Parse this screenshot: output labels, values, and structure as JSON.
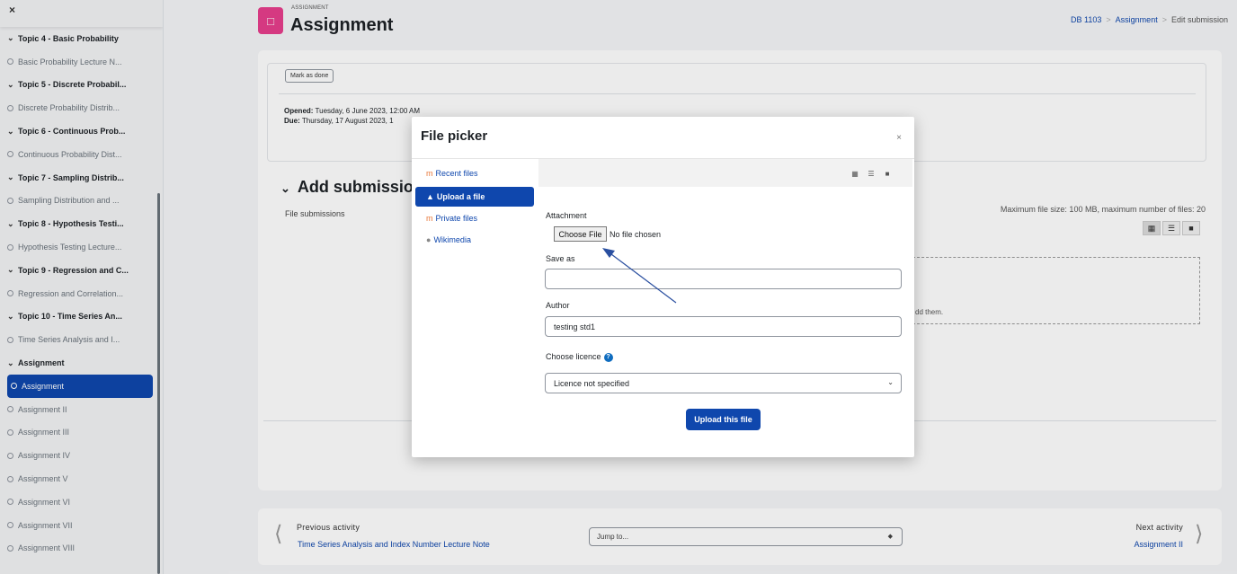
{
  "sidebar": {
    "close_label": "×",
    "items": [
      {
        "kind": "section",
        "label": "Topic 4 - Basic Probability"
      },
      {
        "kind": "activity",
        "label": "Basic Probability Lecture N..."
      },
      {
        "kind": "section",
        "label": "Topic 5 - Discrete Probabil..."
      },
      {
        "kind": "activity",
        "label": "Discrete Probability Distrib..."
      },
      {
        "kind": "section",
        "label": "Topic 6 - Continuous Prob..."
      },
      {
        "kind": "activity",
        "label": "Continuous Probability Dist..."
      },
      {
        "kind": "section",
        "label": "Topic 7 - Sampling Distrib..."
      },
      {
        "kind": "activity",
        "label": "Sampling Distribution and ..."
      },
      {
        "kind": "section",
        "label": "Topic 8 - Hypothesis Testi..."
      },
      {
        "kind": "activity",
        "label": "Hypothesis Testing Lecture..."
      },
      {
        "kind": "section",
        "label": "Topic 9 - Regression and C..."
      },
      {
        "kind": "activity",
        "label": "Regression and Correlation..."
      },
      {
        "kind": "section",
        "label": "Topic 10 - Time Series An..."
      },
      {
        "kind": "activity",
        "label": "Time Series Analysis and I..."
      },
      {
        "kind": "section",
        "label": "Assignment"
      },
      {
        "kind": "activity",
        "label": "Assignment",
        "active": true
      },
      {
        "kind": "activity",
        "label": "Assignment II"
      },
      {
        "kind": "activity",
        "label": "Assignment III"
      },
      {
        "kind": "activity",
        "label": "Assignment IV"
      },
      {
        "kind": "activity",
        "label": "Assignment V"
      },
      {
        "kind": "activity",
        "label": "Assignment VI"
      },
      {
        "kind": "activity",
        "label": "Assignment VII"
      },
      {
        "kind": "activity",
        "label": "Assignment VIII"
      }
    ]
  },
  "header": {
    "module_type": "ASSIGNMENT",
    "title": "Assignment",
    "breadcrumb": {
      "course": "DB 1103",
      "activity": "Assignment",
      "current": "Edit submission",
      "sep": ">"
    }
  },
  "activity": {
    "mark_done_label": "Mark as done",
    "opened_label": "Opened:",
    "opened_value": "Tuesday, 6 June 2023, 12:00 AM",
    "due_label": "Due:",
    "due_value": "Thursday, 17 August 2023, 1"
  },
  "submission": {
    "heading": "Add submission",
    "file_submissions_label": "File submissions",
    "max_size_text": "Maximum file size: 100 MB, maximum number of files: 20",
    "drop_text": "dd them."
  },
  "file_picker": {
    "title": "File picker",
    "close_label": "×",
    "repositories": [
      {
        "label": "Recent files",
        "icon": "moodle-icon"
      },
      {
        "label": "Upload a file",
        "icon": "upload-icon",
        "active": true
      },
      {
        "label": "Private files",
        "icon": "moodle-icon"
      },
      {
        "label": "Wikimedia",
        "icon": "wikimedia-icon"
      }
    ],
    "attachment_label": "Attachment",
    "choose_file_label": "Choose File",
    "no_file_text": "No file chosen",
    "save_as_label": "Save as",
    "save_as_value": "",
    "author_label": "Author",
    "author_value": "testing std1",
    "licence_label": "Choose licence",
    "licence_value": "Licence not specified",
    "upload_button_label": "Upload this file"
  },
  "bottom_nav": {
    "previous_label": "Previous activity",
    "previous_link": "Time Series Analysis and Index Number Lecture Note",
    "jump_placeholder": "Jump to...",
    "next_label": "Next activity",
    "next_link": "Assignment II"
  },
  "colors": {
    "accent": "#0f47ad",
    "module_icon": "#e83e8c"
  }
}
